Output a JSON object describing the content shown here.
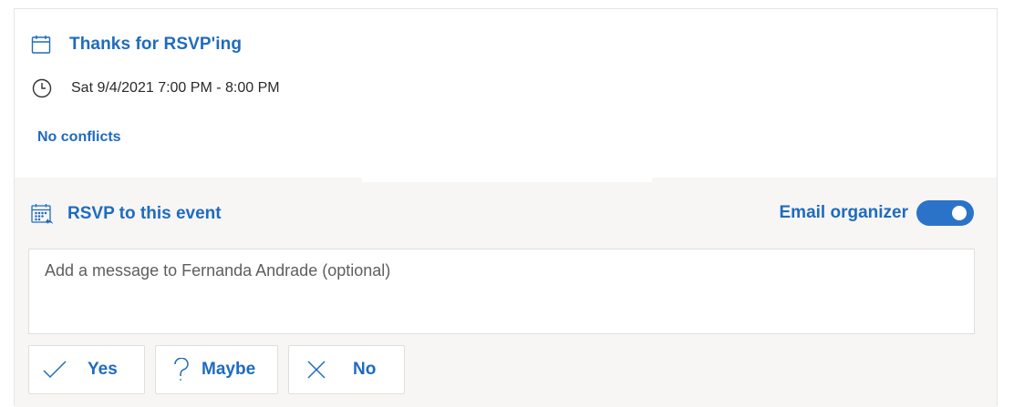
{
  "event": {
    "title": "Thanks for RSVP'ing",
    "time": "Sat 9/4/2021 7:00 PM - 8:00 PM",
    "conflicts": "No conflicts"
  },
  "rsvp": {
    "heading": "RSVP to this event",
    "email_organizer_label": "Email organizer",
    "email_organizer_on": true,
    "message_placeholder": "Add a message to Fernanda Andrade (optional)",
    "buttons": {
      "yes": "Yes",
      "maybe": "Maybe",
      "no": "No"
    }
  },
  "icons": {
    "title": "calendar-icon",
    "time": "clock-icon",
    "rsvp": "calendar-reply-icon",
    "yes": "checkmark-icon",
    "maybe": "question-icon",
    "no": "close-icon"
  },
  "colors": {
    "accent": "#1f6bbf",
    "toggle": "#2b73c8",
    "panel_bg": "#f7f6f5"
  }
}
